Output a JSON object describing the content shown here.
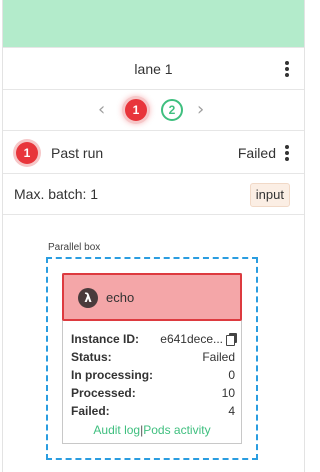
{
  "lane": {
    "title": "lane 1",
    "header_color": "#b3ebcb"
  },
  "pager": {
    "prev_icon": "chevron-left-icon",
    "next_icon": "chevron-right-icon",
    "pages": [
      "1",
      "2"
    ],
    "current_page": "1"
  },
  "run": {
    "badge": "1",
    "label": "Past run",
    "status": "Failed"
  },
  "batch": {
    "label": "Max. batch: 1",
    "input_button": "input"
  },
  "parallel_box": {
    "label": "Parallel box"
  },
  "task": {
    "icon": "λ",
    "name": "echo",
    "fields": {
      "instance_id_label": "Instance ID:",
      "instance_id_value": "e641dece...",
      "status_label": "Status:",
      "status_value": "Failed",
      "in_processing_label": "In processing:",
      "in_processing_value": "0",
      "processed_label": "Processed:",
      "processed_value": "10",
      "failed_label": "Failed:",
      "failed_value": "4"
    },
    "links": {
      "audit_log": "Audit log",
      "separator": "|",
      "pods_activity": "Pods activity"
    }
  },
  "colors": {
    "accent_green": "#3fbf7f",
    "error_red": "#e8353b",
    "parallel_border": "#2a9de0"
  }
}
